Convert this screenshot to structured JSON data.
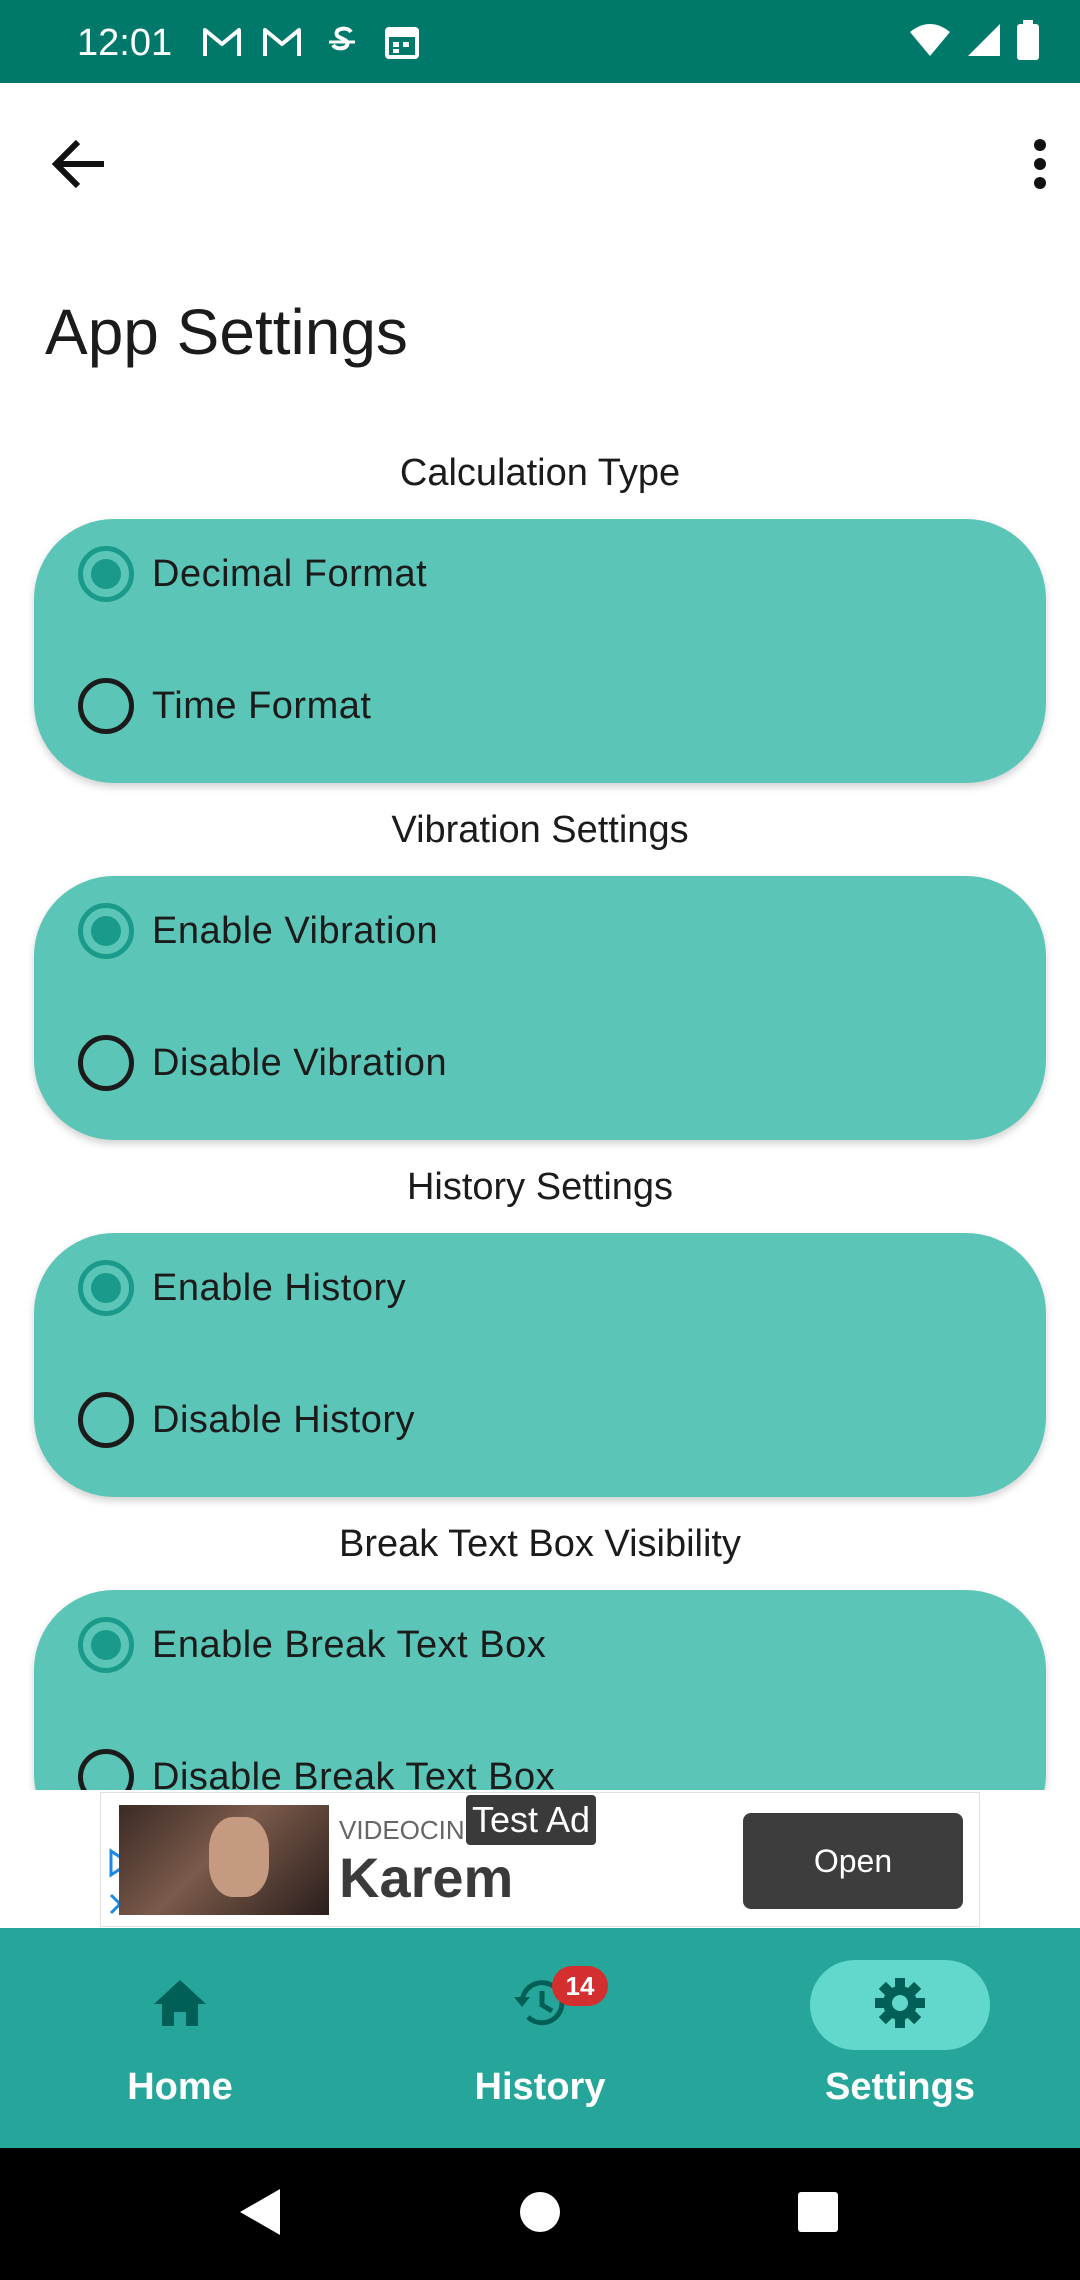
{
  "status_bar": {
    "time": "12:01",
    "icons_left": [
      "gmail-icon",
      "gmail-icon",
      "sim-icon",
      "calendar-icon"
    ],
    "icons_right": [
      "wifi-icon",
      "signal-icon",
      "battery-icon"
    ]
  },
  "app_bar": {
    "back_icon": "arrow-back-icon",
    "overflow_icon": "more-vert-icon"
  },
  "page": {
    "title": "App Settings"
  },
  "sections": [
    {
      "title": "Calculation Type",
      "options": [
        {
          "label": "Decimal Format",
          "selected": true
        },
        {
          "label": "Time Format",
          "selected": false
        }
      ]
    },
    {
      "title": "Vibration Settings",
      "options": [
        {
          "label": "Enable Vibration",
          "selected": true
        },
        {
          "label": "Disable Vibration",
          "selected": false
        }
      ]
    },
    {
      "title": "History Settings",
      "options": [
        {
          "label": "Enable History",
          "selected": true
        },
        {
          "label": "Disable History",
          "selected": false
        }
      ]
    },
    {
      "title": "Break Text Box Visibility",
      "options": [
        {
          "label": "Enable Break Text Box",
          "selected": true
        },
        {
          "label": "Disable Break Text Box",
          "selected": false
        }
      ]
    }
  ],
  "ad": {
    "source": "VIDEOCINE",
    "brand": "Karem",
    "test_label": "Test Ad",
    "open_label": "Open"
  },
  "bottom_nav": {
    "items": [
      {
        "label": "Home",
        "icon": "home-icon",
        "active": false
      },
      {
        "label": "History",
        "icon": "history-icon",
        "active": false,
        "badge": "14"
      },
      {
        "label": "Settings",
        "icon": "gear-icon",
        "active": true
      }
    ]
  },
  "colors": {
    "status_bar": "#00796b",
    "card": "#5bc5b7",
    "radio_checked": "#1a9a8a",
    "bottom_nav": "#26a69a",
    "nav_active_pill": "#62d8cc",
    "badge": "#d32f2f"
  }
}
